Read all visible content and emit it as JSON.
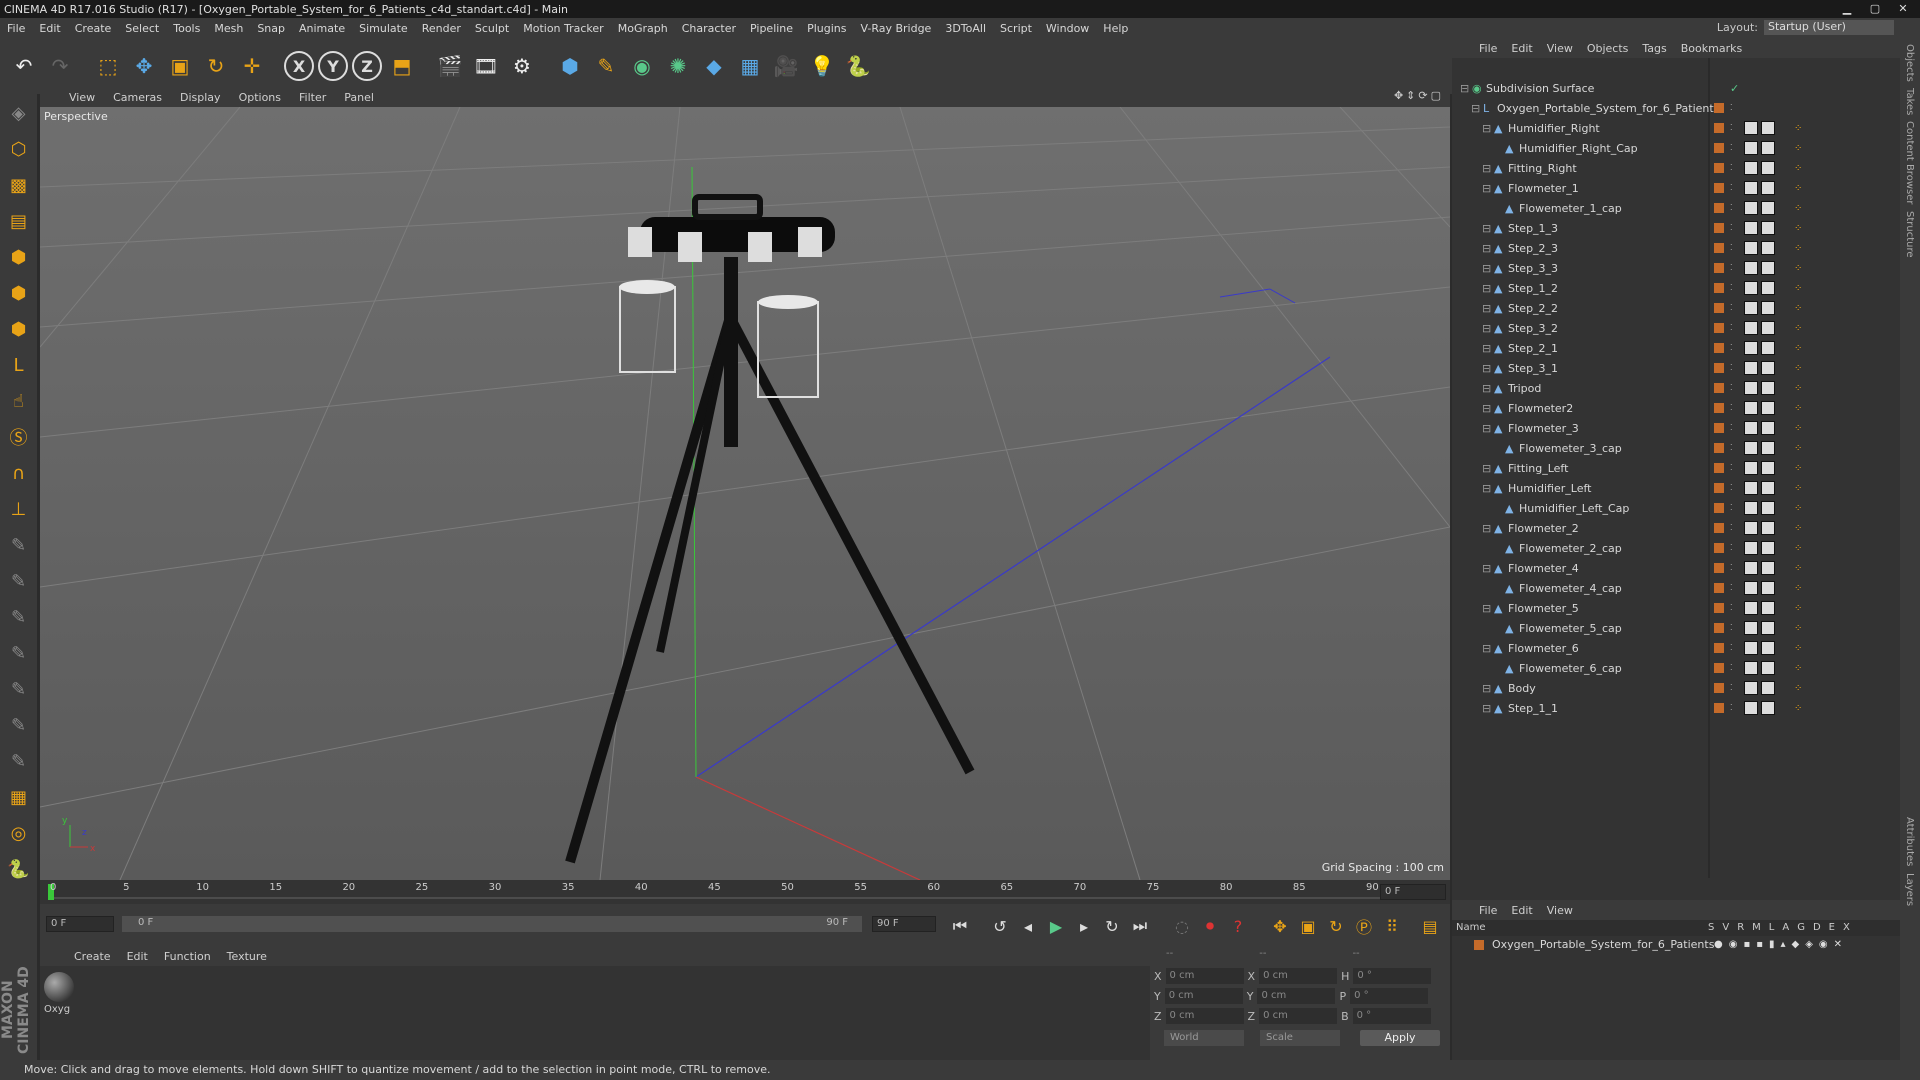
{
  "window": {
    "title": "CINEMA 4D R17.016 Studio (R17) - [Oxygen_Portable_System_for_6_Patients_c4d_standart.c4d] - Main"
  },
  "menubar": {
    "items": [
      "File",
      "Edit",
      "Create",
      "Select",
      "Tools",
      "Mesh",
      "Snap",
      "Animate",
      "Simulate",
      "Render",
      "Sculpt",
      "Motion Tracker",
      "MoGraph",
      "Character",
      "Pipeline",
      "Plugins",
      "V-Ray Bridge",
      "3DToAll",
      "Script",
      "Window",
      "Help"
    ],
    "layout_label": "Layout:",
    "layout_value": "Startup (User)"
  },
  "viewport": {
    "menu": [
      "View",
      "Cameras",
      "Display",
      "Options",
      "Filter",
      "Panel"
    ],
    "label": "Perspective",
    "grid_spacing": "Grid Spacing : 100 cm"
  },
  "timeline": {
    "ticks": [
      "0",
      "5",
      "10",
      "15",
      "20",
      "25",
      "30",
      "35",
      "40",
      "45",
      "50",
      "55",
      "60",
      "65",
      "70",
      "75",
      "80",
      "85",
      "90"
    ],
    "current_frame_right": "0 F",
    "start_field": "0 F",
    "range_start": "0 F",
    "range_end": "90 F",
    "end_field": "90 F"
  },
  "material_manager": {
    "menu": [
      "Create",
      "Edit",
      "Function",
      "Texture"
    ],
    "materials": [
      {
        "name": "Oxyg"
      }
    ]
  },
  "coordinates": {
    "headers": [
      "--",
      "--",
      "--"
    ],
    "rows": [
      {
        "a": "X",
        "av": "0 cm",
        "b": "X",
        "bv": "0 cm",
        "c": "H",
        "cv": "0 °"
      },
      {
        "a": "Y",
        "av": "0 cm",
        "b": "Y",
        "bv": "0 cm",
        "c": "P",
        "cv": "0 °"
      },
      {
        "a": "Z",
        "av": "0 cm",
        "b": "Z",
        "bv": "0 cm",
        "c": "B",
        "cv": "0 °"
      }
    ],
    "world": "World",
    "scale": "Scale",
    "apply": "Apply"
  },
  "status": {
    "text": "Move: Click and drag to move elements. Hold down SHIFT to quantize movement / add to the selection in point mode, CTRL to remove."
  },
  "object_manager": {
    "menu": [
      "File",
      "Edit",
      "View",
      "Objects",
      "Tags",
      "Bookmarks"
    ],
    "objects": [
      {
        "name": "Subdivision Surface",
        "depth": 0
      },
      {
        "name": "Oxygen_Portable_System_for_6_Patients",
        "depth": 1
      },
      {
        "name": "Humidifier_Right",
        "depth": 2
      },
      {
        "name": "Humidifier_Right_Cap",
        "depth": 3
      },
      {
        "name": "Fitting_Right",
        "depth": 2
      },
      {
        "name": "Flowmeter_1",
        "depth": 2
      },
      {
        "name": "Flowemeter_1_cap",
        "depth": 3
      },
      {
        "name": "Step_1_3",
        "depth": 2
      },
      {
        "name": "Step_2_3",
        "depth": 2
      },
      {
        "name": "Step_3_3",
        "depth": 2
      },
      {
        "name": "Step_1_2",
        "depth": 2
      },
      {
        "name": "Step_2_2",
        "depth": 2
      },
      {
        "name": "Step_3_2",
        "depth": 2
      },
      {
        "name": "Step_2_1",
        "depth": 2
      },
      {
        "name": "Step_3_1",
        "depth": 2
      },
      {
        "name": "Tripod",
        "depth": 2
      },
      {
        "name": "Flowmeter2",
        "depth": 2
      },
      {
        "name": "Flowmeter_3",
        "depth": 2
      },
      {
        "name": "Flowemeter_3_cap",
        "depth": 3
      },
      {
        "name": "Fitting_Left",
        "depth": 2
      },
      {
        "name": "Humidifier_Left",
        "depth": 2
      },
      {
        "name": "Humidifier_Left_Cap",
        "depth": 3
      },
      {
        "name": "Flowmeter_2",
        "depth": 2
      },
      {
        "name": "Flowemeter_2_cap",
        "depth": 3
      },
      {
        "name": "Flowmeter_4",
        "depth": 2
      },
      {
        "name": "Flowemeter_4_cap",
        "depth": 3
      },
      {
        "name": "Flowmeter_5",
        "depth": 2
      },
      {
        "name": "Flowemeter_5_cap",
        "depth": 3
      },
      {
        "name": "Flowmeter_6",
        "depth": 2
      },
      {
        "name": "Flowemeter_6_cap",
        "depth": 3
      },
      {
        "name": "Body",
        "depth": 2
      },
      {
        "name": "Step_1_1",
        "depth": 2
      }
    ]
  },
  "layer_manager": {
    "menu": [
      "File",
      "Edit",
      "View"
    ],
    "header_name": "Name",
    "header_cols": [
      "S",
      "V",
      "R",
      "M",
      "L",
      "A",
      "G",
      "D",
      "E",
      "X"
    ],
    "layers": [
      {
        "name": "Oxygen_Portable_System_for_6_Patients"
      }
    ]
  },
  "side_tabs": [
    "Objects",
    "Takes",
    "Content Browser",
    "Structure",
    "Attributes",
    "Layers"
  ],
  "colors": {
    "accent": "#e8a317",
    "layer_color": "#c56b2a"
  }
}
